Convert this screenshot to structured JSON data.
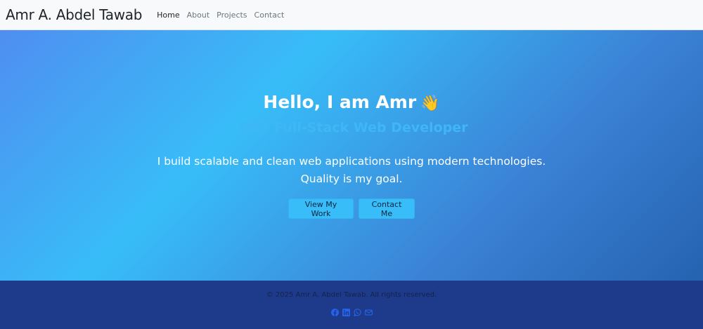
{
  "nav": {
    "brand": "Amr A. Abdel Tawab",
    "links": [
      {
        "label": "Home"
      },
      {
        "label": "About"
      },
      {
        "label": "Projects"
      },
      {
        "label": "Contact"
      }
    ]
  },
  "hero": {
    "title": "Hello, I am Amr",
    "wave": "👋",
    "subtitle": ".NET Full-Stack Web Developer",
    "description": "I build scalable and clean web applications using modern technologies. Quality is my goal.",
    "buttons": {
      "work": "View My Work",
      "contact": "Contact Me"
    }
  },
  "footer": {
    "copyright": "© 2025 Amr A. Abdel Tawab. All rights reserved.",
    "socials": [
      "facebook-icon",
      "linkedin-icon",
      "whatsapp-icon",
      "email-icon"
    ]
  },
  "colors": {
    "accent": "#38bdf8",
    "footer_bg": "#1e3a8a",
    "social_icon": "#2563eb"
  }
}
